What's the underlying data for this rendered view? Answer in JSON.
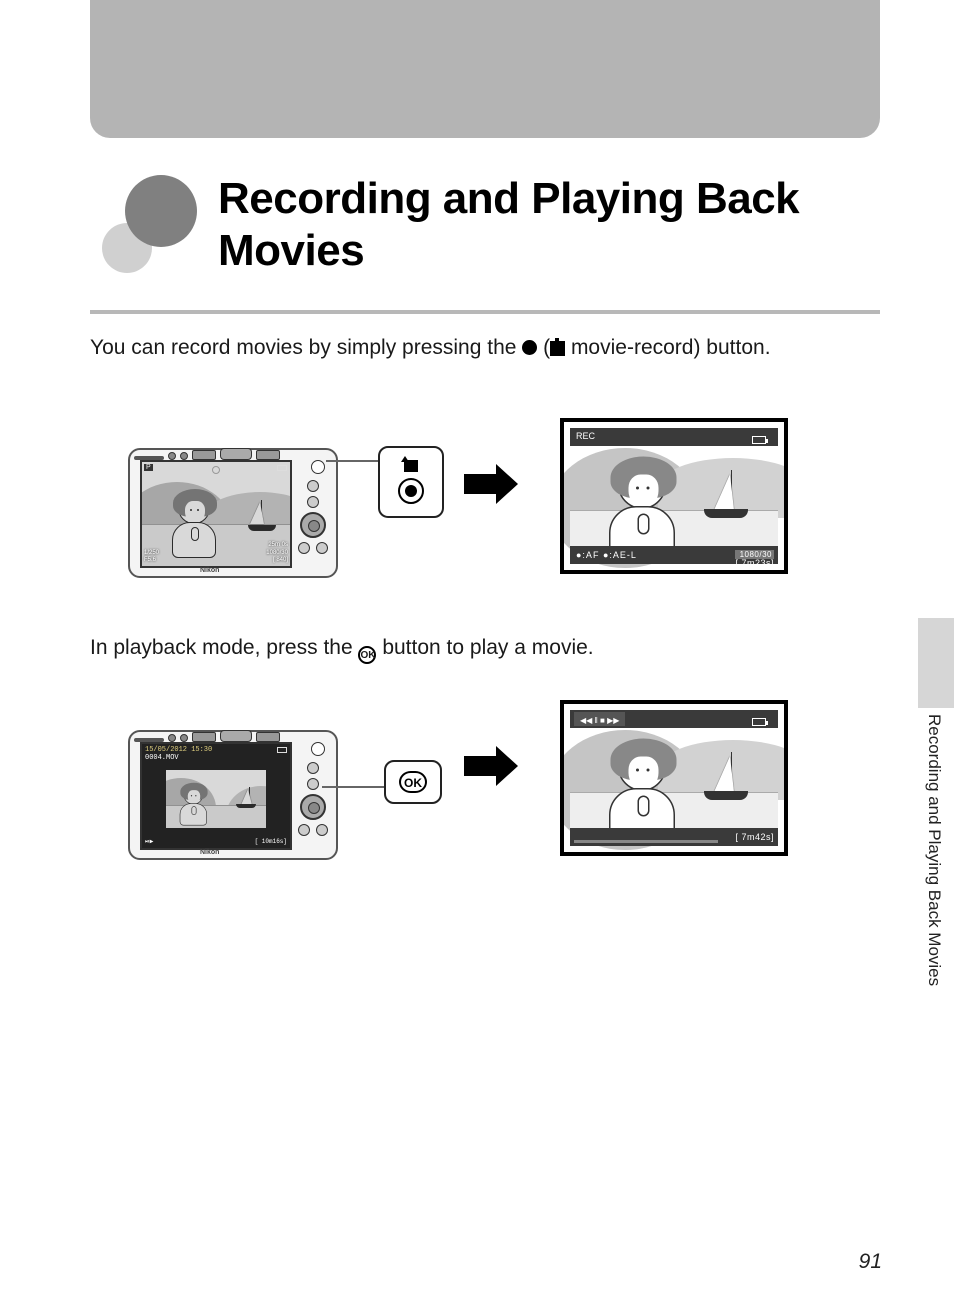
{
  "title": "Recording and Playing Back Movies",
  "intro": {
    "pre": "You can record movies by simply pressing the ",
    "mid": " (",
    "post": " movie-record) button."
  },
  "playback_text": {
    "pre": "In playback mode, press the ",
    "ok": "OK",
    "post": " button to play a movie."
  },
  "figure1": {
    "camera_brand": "Nikon",
    "screen": {
      "mode": "P",
      "br1": "25m 0s",
      "br2": "1080/30",
      "br3": "[   840]",
      "bl1": "1/250",
      "bl2": "F5.6"
    },
    "callout": {
      "label": "REC"
    },
    "result": {
      "top_left": "REC",
      "bottom_left": "●:AF  ●:AE-L",
      "resolution": "1080/30",
      "time": "[   7m23s]"
    }
  },
  "figure2": {
    "camera_brand": "Nikon",
    "screen": {
      "date": "15/05/2012 15:30",
      "file": "0004.MOV",
      "footer_left": "⏯▶",
      "footer_right": "[  10m16s]"
    },
    "callout": {
      "label": "OK"
    },
    "result": {
      "controls": "◀◀  ‖  ■  ▶▶",
      "time": "[   7m42s]"
    }
  },
  "side_label": "Recording and Playing Back Movies",
  "page_number": "91"
}
